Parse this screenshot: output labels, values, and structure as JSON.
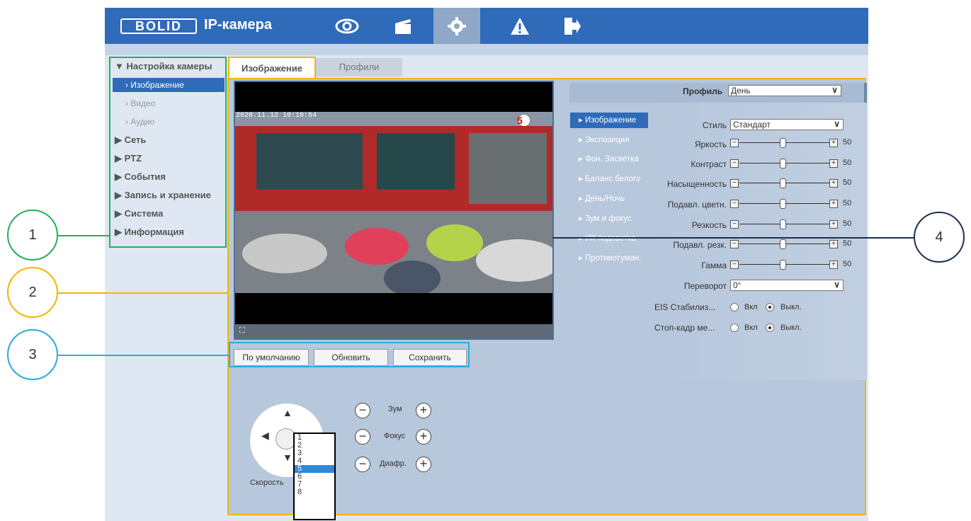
{
  "header": {
    "logo": "BOLID",
    "app_title": "IP-камера"
  },
  "nav_icons": [
    "eye-icon",
    "clapper-icon",
    "gear-icon",
    "warning-icon",
    "exit-icon"
  ],
  "sidebar": {
    "section": "▼ Настройка камеры",
    "sub": [
      "Изображение",
      "Видео",
      "Аудио"
    ],
    "items": [
      "Сеть",
      "PTZ",
      "События",
      "Запись и хранение",
      "Система",
      "Информация"
    ]
  },
  "tabs": {
    "image": "Изображение",
    "profiles": "Профили"
  },
  "video": {
    "timestamp": "2020.11.12 10:10:54"
  },
  "buttons": {
    "default": "По умолчанию",
    "refresh": "Обновить",
    "save": "Сохранить"
  },
  "profile": {
    "label": "Профиль",
    "value": "День"
  },
  "menu": [
    "Изображение",
    "Экспозиция",
    "Фон. Засветка",
    "Баланс белого",
    "День/Ночь",
    "Зум и фокус",
    "ИК подсветка",
    "Противотуман."
  ],
  "style": {
    "label": "Стиль",
    "value": "Стандарт"
  },
  "sliders": [
    {
      "label": "Яркость",
      "value": "50"
    },
    {
      "label": "Контраст",
      "value": "50"
    },
    {
      "label": "Насыщенность",
      "value": "50"
    },
    {
      "label": "Подавл. цветн.",
      "value": "50"
    },
    {
      "label": "Резкость",
      "value": "50"
    },
    {
      "label": "Подавл. резк.",
      "value": "50"
    },
    {
      "label": "Гамма",
      "value": "50"
    }
  ],
  "flip": {
    "label": "Переворот",
    "value": "0°"
  },
  "eis": {
    "label": "EIS Стабилиз...",
    "on": "Вкл",
    "off": "Выкл."
  },
  "freeze": {
    "label": "Стоп-кадр ме...",
    "on": "Вкл",
    "off": "Выкл."
  },
  "ptz": {
    "zoom": "Зум",
    "focus": "Фокус",
    "iris": "Диафр.",
    "speed": "Скорость",
    "speed_options": [
      "1",
      "2",
      "3",
      "4",
      "5",
      "6",
      "7",
      "8"
    ],
    "speed_selected": "5"
  },
  "callouts": [
    "1",
    "2",
    "3",
    "4"
  ],
  "colors": {
    "accent": "#2f6bb8",
    "callout1": "#27ae60",
    "callout2": "#f2b600",
    "callout3": "#29abe2",
    "callout4": "#1d2f4d"
  }
}
